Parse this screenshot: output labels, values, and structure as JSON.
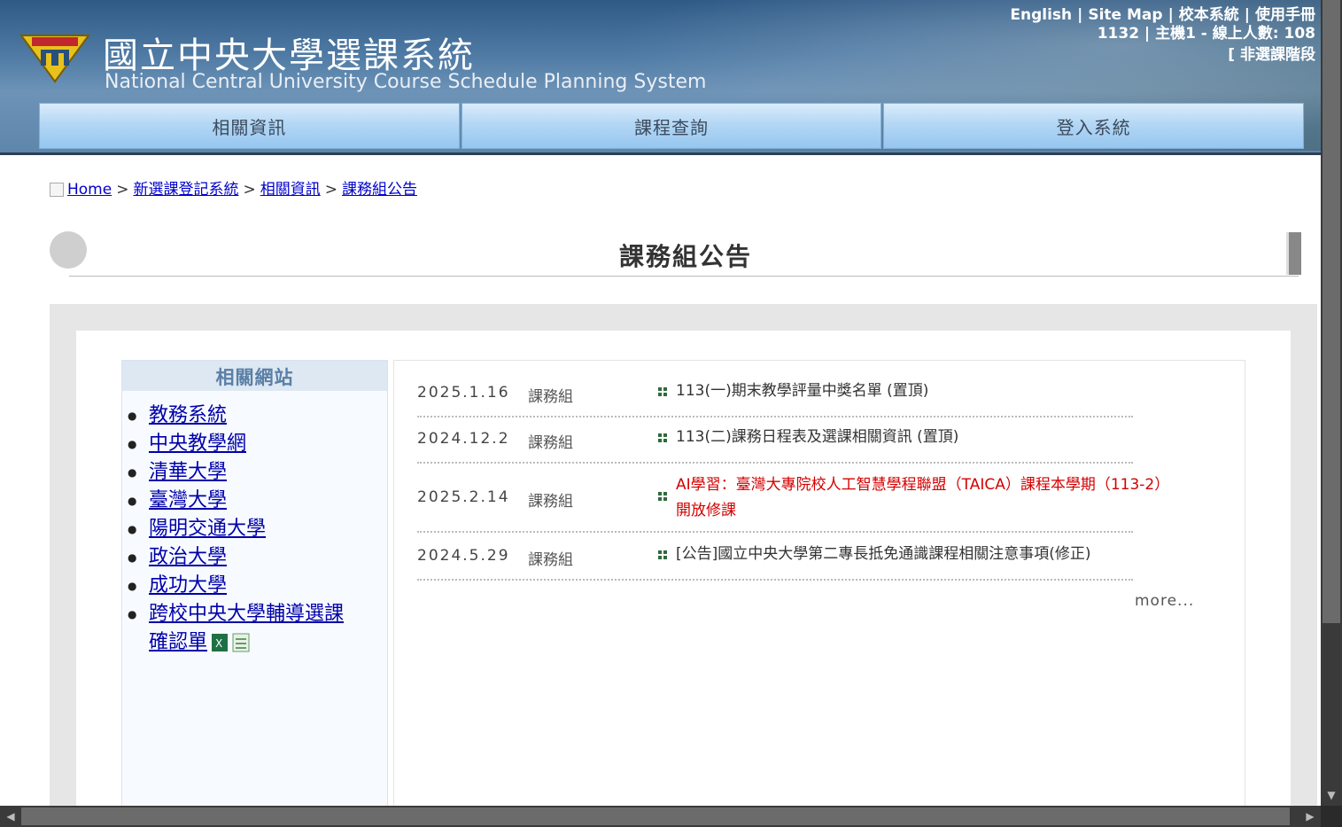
{
  "header": {
    "title_zh": "國立中央大學選課系統",
    "title_en": "National Central University Course Schedule Planning System",
    "top_links": [
      "English",
      "Site Map",
      "校本系統",
      "使用手冊"
    ],
    "stats_line": "1132 | 主機1 - 線上人數: 108",
    "phase": "[ 非選課階段"
  },
  "nav": {
    "items": [
      "相關資訊",
      "課程查詢",
      "登入系統"
    ]
  },
  "breadcrumb": {
    "items": [
      "Home",
      "新選課登記系統",
      "相關資訊",
      "課務組公告"
    ],
    "separator": ">"
  },
  "page_title": "課務組公告",
  "sidebar": {
    "title": "相關網站",
    "links": [
      "教務系統",
      "中央教學網",
      "清華大學",
      "臺灣大學",
      "陽明交通大學",
      "政治大學",
      "成功大學"
    ],
    "last_link_part1": "跨校中央大學輔導選課",
    "last_link_part2": "確認單",
    "file_icons": [
      "excel-file-icon",
      "spreadsheet-file-icon"
    ]
  },
  "news": {
    "rows": [
      {
        "date": "2025.1.16",
        "unit": "課務組",
        "title": "113(一)期末教學評量中獎名單 (置頂)",
        "color": "#333333"
      },
      {
        "date": "2024.12.2",
        "unit": "課務組",
        "title": "113(二)課務日程表及選課相關資訊 (置頂)",
        "color": "#333333"
      },
      {
        "date": "2025.2.14",
        "unit": "課務組",
        "title": "AI學習：臺灣大專院校人工智慧學程聯盟（TAICA）課程本學期（113-2）開放修課",
        "color": "#d40000"
      },
      {
        "date": "2024.5.29",
        "unit": "課務組",
        "title": "[公告]國立中央大學第二專長抵免通識課程相關注意事項(修正)",
        "color": "#333333"
      }
    ],
    "more": "more..."
  }
}
